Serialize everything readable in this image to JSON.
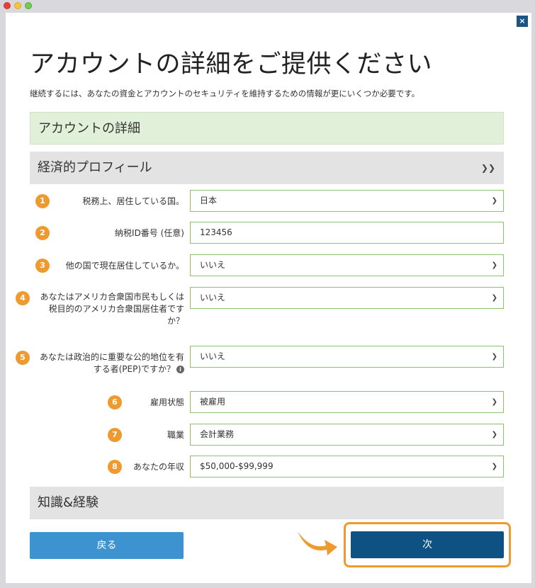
{
  "window": {
    "close_label": "×"
  },
  "header": {
    "title": "アカウントの詳細をご提供ください",
    "subtitle": "継続するには、あなたの資金とアカウントのセキュリティを維持するための情報が更にいくつか必要です。"
  },
  "sections": {
    "account_details": "アカウントの詳細",
    "economic_profile": "経済的プロフィール",
    "knowledge": "知識&経験"
  },
  "form": {
    "fields": [
      {
        "num": "1",
        "label": "税務上、居住している国。",
        "value": "日本",
        "type": "select"
      },
      {
        "num": "2",
        "label": "納税ID番号 (任意)",
        "value": "123456",
        "type": "input"
      },
      {
        "num": "3",
        "label": "他の国で現在居住しているか。",
        "value": "いいえ",
        "type": "select"
      },
      {
        "num": "4",
        "label": "あなたはアメリカ合衆国市民もしくは税目的のアメリカ合衆国居住者ですか？",
        "value": "いいえ",
        "type": "select"
      },
      {
        "num": "5",
        "label": "あなたは政治的に重要な公的地位を有する者(PEP)ですか？",
        "value": "いいえ",
        "type": "select"
      },
      {
        "num": "6",
        "label": "雇用状態",
        "value": "被雇用",
        "type": "select"
      },
      {
        "num": "7",
        "label": "職業",
        "value": "会計業務",
        "type": "select"
      },
      {
        "num": "8",
        "label": "あなたの年収",
        "value": "$50,000-$99,999",
        "type": "select"
      }
    ]
  },
  "buttons": {
    "back": "戻る",
    "next": "次"
  },
  "colors": {
    "accent": "#ef9a2f",
    "primary": "#0e5283",
    "secondary": "#3d93cf",
    "field_border": "#8cc26e",
    "section_green": "#e1f0d8"
  }
}
